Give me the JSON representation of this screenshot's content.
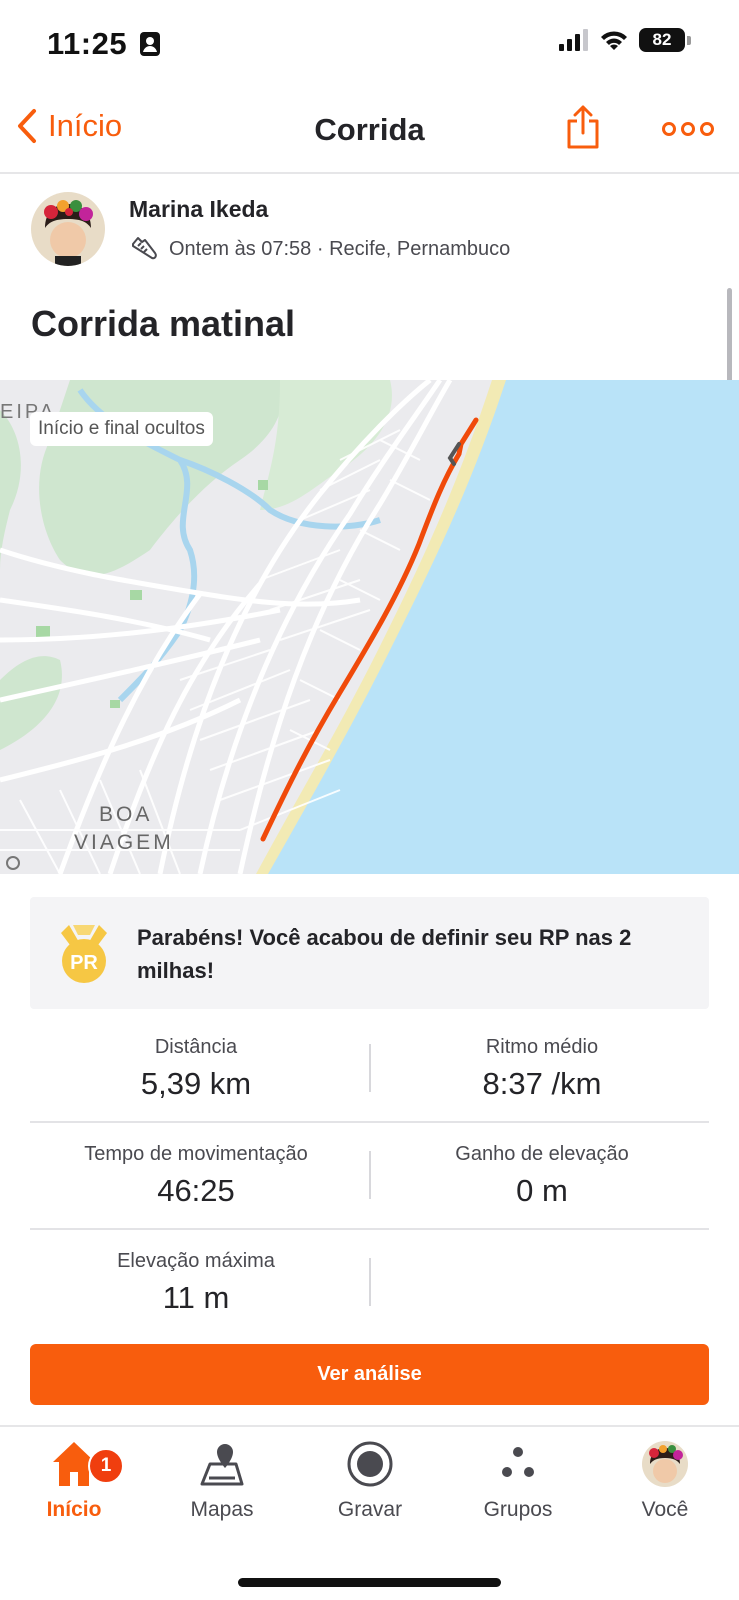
{
  "status_bar": {
    "time": "11:25",
    "battery": "82"
  },
  "nav": {
    "back_label": "Início",
    "title": "Corrida"
  },
  "athlete": {
    "name": "Marina Ikeda",
    "meta": "Ontem às 07:58 · Recife, Pernambuco"
  },
  "activity": {
    "title": "Corrida matinal"
  },
  "map": {
    "privacy_chip": "Início e final ocultos",
    "labels": {
      "top_left": "EIPA",
      "district_line1": "BOA",
      "district_line2": "VIAGEM"
    },
    "route_color": "#f04a0a",
    "sea_color": "#b9e3f8"
  },
  "pr": {
    "message": "Parabéns! Você acabou de definir seu RP nas 2 milhas!",
    "badge": "PR"
  },
  "stats": [
    {
      "label": "Distância",
      "value": "5,39 km"
    },
    {
      "label": "Ritmo médio",
      "value": "8:37 /km"
    },
    {
      "label": "Tempo de movimentação",
      "value": "46:25"
    },
    {
      "label": "Ganho de elevação",
      "value": "0 m"
    },
    {
      "label": "Elevação máxima",
      "value": "11 m"
    }
  ],
  "cta_label": "Ver análise",
  "tabs": [
    {
      "label": "Início",
      "icon": "home-icon",
      "active": true,
      "badge": "1"
    },
    {
      "label": "Mapas",
      "icon": "map-icon"
    },
    {
      "label": "Gravar",
      "icon": "record-icon"
    },
    {
      "label": "Grupos",
      "icon": "groups-icon"
    },
    {
      "label": "Você",
      "icon": "avatar"
    }
  ],
  "colors": {
    "accent": "#f85d0d",
    "pr_gold": "#f6c744"
  }
}
